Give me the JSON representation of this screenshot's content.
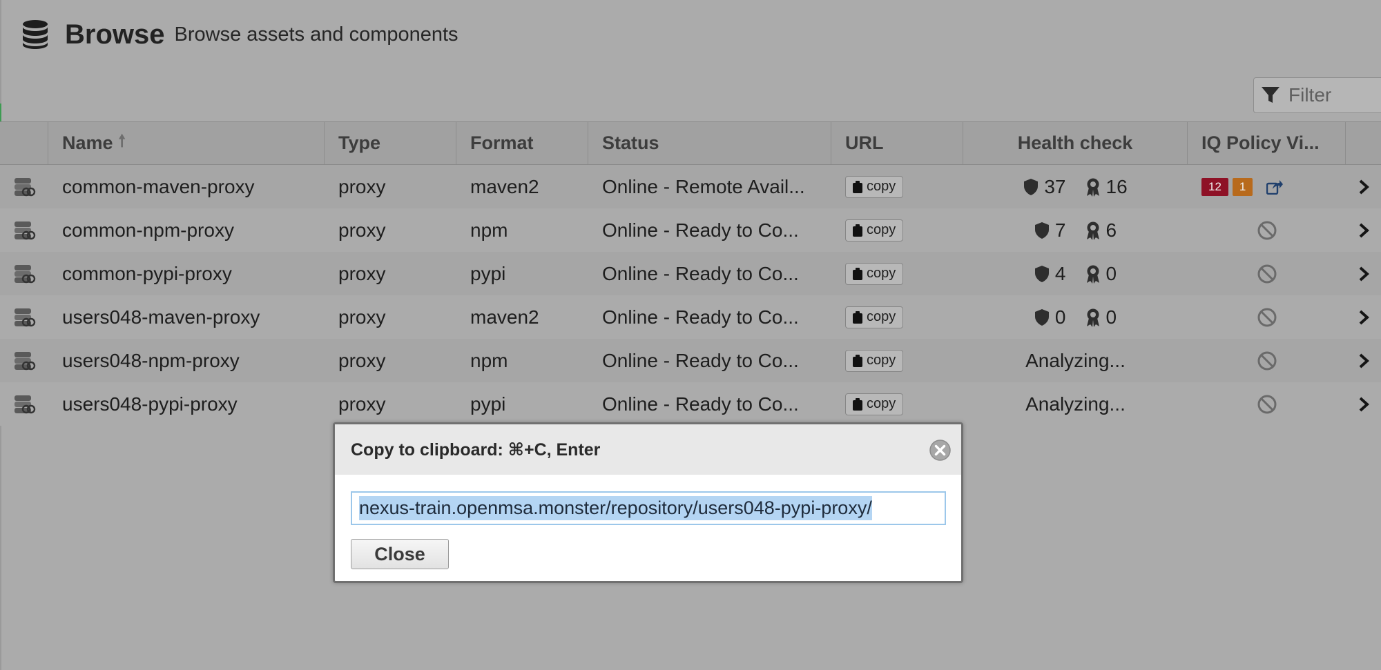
{
  "header": {
    "title": "Browse",
    "subtitle": "Browse assets and components",
    "icon": "database-icon"
  },
  "filter": {
    "placeholder": "Filter"
  },
  "columns": {
    "name": "Name",
    "type": "Type",
    "format": "Format",
    "status": "Status",
    "url": "URL",
    "health": "Health check",
    "iq": "IQ Policy Vi..."
  },
  "copy_label": "copy",
  "rows": [
    {
      "name": "common-maven-proxy",
      "type": "proxy",
      "format": "maven2",
      "status": "Online - Remote Avail...",
      "health": {
        "security": "37",
        "license": "16"
      },
      "iq": {
        "critical": "12",
        "severe": "1"
      }
    },
    {
      "name": "common-npm-proxy",
      "type": "proxy",
      "format": "npm",
      "status": "Online - Ready to Co...",
      "health": {
        "security": "7",
        "license": "6"
      }
    },
    {
      "name": "common-pypi-proxy",
      "type": "proxy",
      "format": "pypi",
      "status": "Online - Ready to Co...",
      "health": {
        "security": "4",
        "license": "0"
      }
    },
    {
      "name": "users048-maven-proxy",
      "type": "proxy",
      "format": "maven2",
      "status": "Online - Ready to Co...",
      "health": {
        "security": "0",
        "license": "0"
      }
    },
    {
      "name": "users048-npm-proxy",
      "type": "proxy",
      "format": "npm",
      "status": "Online - Ready to Co...",
      "health_text": "Analyzing..."
    },
    {
      "name": "users048-pypi-proxy",
      "type": "proxy",
      "format": "pypi",
      "status": "Online - Ready to Co...",
      "health_text": "Analyzing..."
    }
  ],
  "modal": {
    "title": "Copy to clipboard: ⌘+C, Enter",
    "url_value": "nexus-train.openmsa.monster/repository/users048-pypi-proxy/",
    "close_label": "Close"
  },
  "colors": {
    "iq_critical": "#8e1126",
    "iq_severe": "#b86a1c",
    "share_link": "#1f3f6c",
    "selection": "#b4d5f3"
  }
}
